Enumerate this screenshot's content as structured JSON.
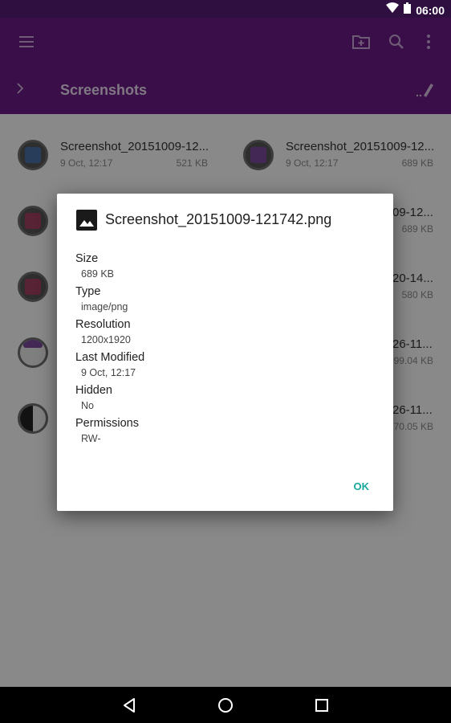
{
  "status_bar": {
    "time": "06:00"
  },
  "toolbar": {
    "icons": [
      "menu-icon",
      "new-folder-icon",
      "search-icon",
      "more-vert-icon"
    ]
  },
  "breadcrumb": {
    "title": "Screenshots"
  },
  "files": [
    {
      "name": "Screenshot_20151009-12...",
      "date": "9 Oct, 12:17",
      "size": "521 KB"
    },
    {
      "name": "Screenshot_20151009-12...",
      "date": "9 Oct, 12:17",
      "size": "689 KB"
    },
    {
      "name": "",
      "date": "",
      "size": ""
    },
    {
      "name": "09-12...",
      "date": "",
      "size": "689 KB"
    },
    {
      "name": "",
      "date": "",
      "size": ""
    },
    {
      "name": "20-14...",
      "date": "",
      "size": "580 KB"
    },
    {
      "name": "",
      "date": "",
      "size": ""
    },
    {
      "name": "26-11...",
      "date": "",
      "size": "99.04 KB"
    },
    {
      "name": "",
      "date": "",
      "size": ""
    },
    {
      "name": "26-11...",
      "date": "",
      "size": "70.05 KB"
    }
  ],
  "dialog": {
    "title": "Screenshot_20151009-121742.png",
    "properties": [
      {
        "label": "Size",
        "value": "689 KB"
      },
      {
        "label": "Type",
        "value": "image/png"
      },
      {
        "label": "Resolution",
        "value": "1200x1920"
      },
      {
        "label": "Last Modified",
        "value": "9 Oct, 12:17"
      },
      {
        "label": "Hidden",
        "value": "No"
      },
      {
        "label": "Permissions",
        "value": "RW-"
      }
    ],
    "ok_label": "OK"
  },
  "colors": {
    "primary": "#6a1b83",
    "status": "#2f0f40",
    "accent": "#1aa89c"
  }
}
